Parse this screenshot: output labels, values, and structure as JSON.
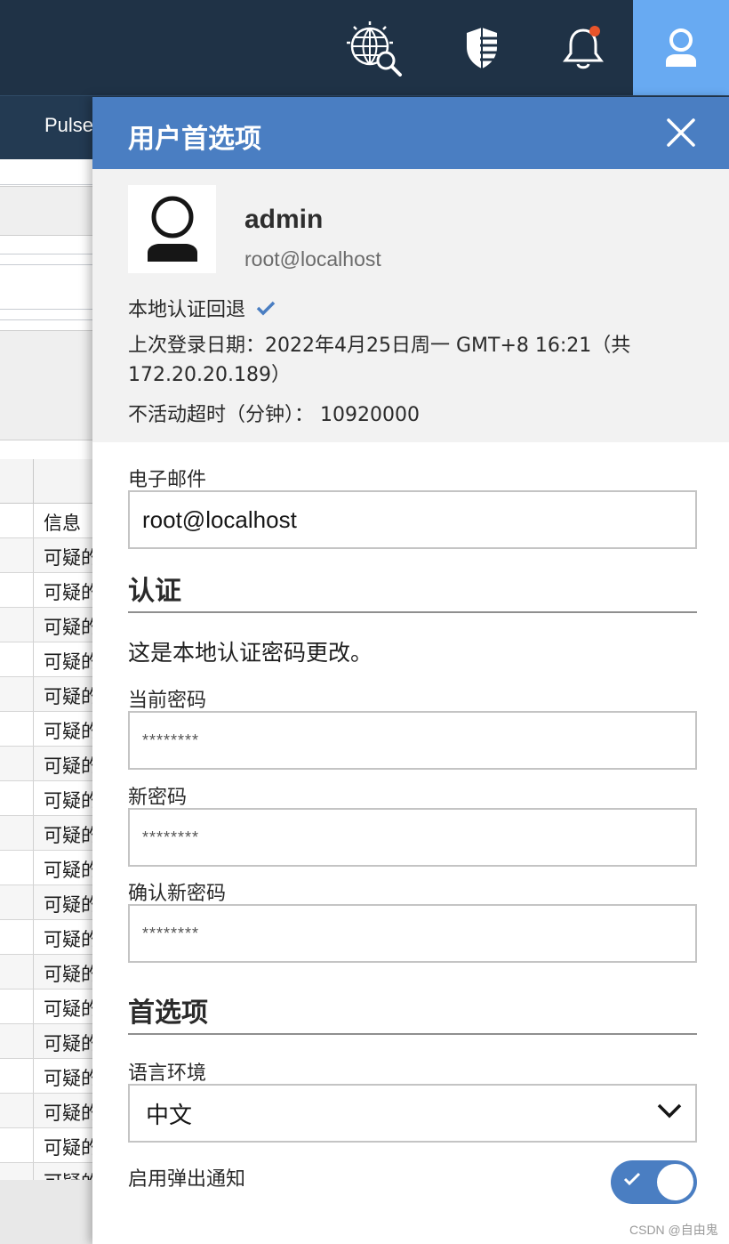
{
  "topbar": {
    "icons": [
      "watson-search-icon",
      "shield-icon",
      "bell-icon",
      "user-icon"
    ],
    "accent_color": "#68aaf2",
    "notification_dot_color": "#e8542a"
  },
  "subnav": {
    "label": "Pulse"
  },
  "background_table": {
    "header": "信息",
    "rows": [
      "可疑的",
      "可疑的",
      "可疑的",
      "可疑的",
      "可疑的",
      "可疑的",
      "可疑的",
      "可疑的",
      "可疑的",
      "可疑的",
      "可疑的",
      "可疑的",
      "可疑的",
      "可疑的",
      "可疑的",
      "可疑的",
      "可疑的",
      "可疑的",
      "可疑的"
    ]
  },
  "panel": {
    "title": "用户首选项",
    "header_color": "#4a7ec2",
    "profile": {
      "username": "admin",
      "email": "root@localhost",
      "auth_fallback": "本地认证回退",
      "last_login": "上次登录日期：2022年4月25日周一 GMT+8 16:21（共172.20.20.189）",
      "inactivity": "不活动超时（分钟）： 10920000"
    },
    "email_field": {
      "label": "电子邮件",
      "value": "root@localhost"
    },
    "auth_section": {
      "title": "认证",
      "note": "这是本地认证密码更改。",
      "current_password": {
        "label": "当前密码",
        "value": "********"
      },
      "new_password": {
        "label": "新密码",
        "value": "********"
      },
      "confirm_password": {
        "label": "确认新密码",
        "value": "********"
      }
    },
    "prefs_section": {
      "title": "首选项",
      "locale": {
        "label": "语言环境",
        "value": "中文"
      },
      "popup": {
        "label": "启用弹出通知",
        "enabled": true
      }
    }
  },
  "watermark": "CSDN @自由鬼"
}
